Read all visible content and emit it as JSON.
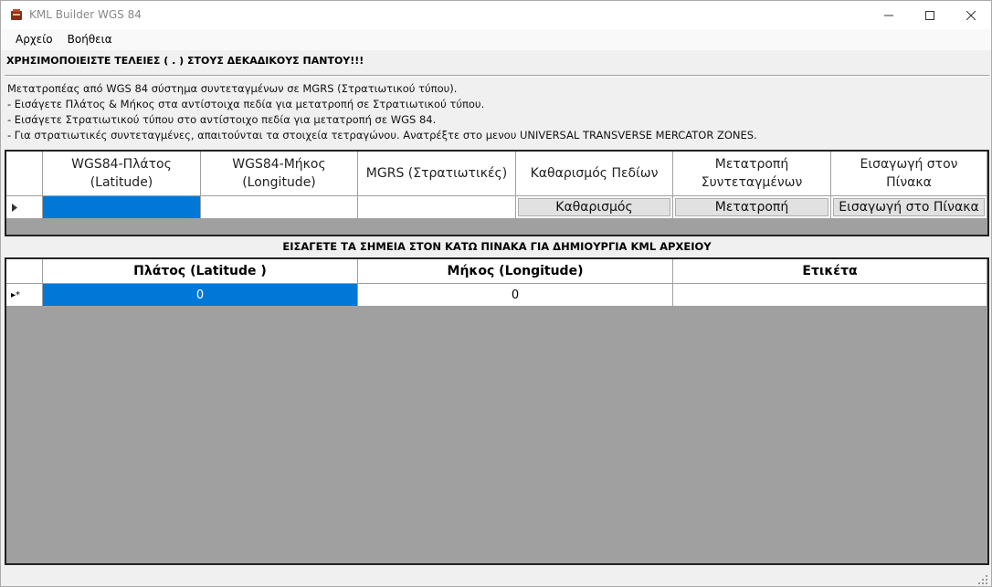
{
  "window": {
    "title": "KML Builder WGS 84"
  },
  "menu": {
    "items": [
      "Αρχείο",
      "Βοήθεια"
    ]
  },
  "warning": "ΧΡΗΣΙΜΟΠΟΙΕΙΣΤΕ ΤΕΛΕΙΕΣ ( . ) ΣΤΟΥΣ ΔΕΚΑΔΙΚΟΥΣ ΠΑΝΤΟΥ!!!",
  "info_lines": [
    "Μετατροπέας από WGS 84 σύστημα συντεταγμένων σε MGRS (Στρατιωτικού τύπου).",
    "- Εισάγετε Πλάτος & Μήκος στα αντίστοιχα πεδία για μετατροπή σε Στρατιωτικού τύπου.",
    "- Εισάγετε Στρατιωτικού τύπου στο αντίστοιχο πεδία για μετατροπή σε WGS 84.",
    "- Για στρατιωτικές συντεταγμένες, απαιτούνται τα στοιχεία τετραγώνου. Ανατρέξτε στο μενου UNIVERSAL TRANSVERSE MERCATOR ZONES."
  ],
  "converter_grid": {
    "headers": [
      "WGS84-Πλάτος\n(Latitude)",
      "WGS84-Μήκος\n(Longitude)",
      "MGRS (Στρατιωτικές)",
      "Καθαρισμός Πεδίων",
      "Μετατροπή\nΣυντεταγμένων",
      "Εισαγωγή στον\nΠίνακα"
    ],
    "row": {
      "latitude": "",
      "longitude": "",
      "mgrs": "",
      "clear_button": "Καθαρισμός",
      "convert_button": "Μετατροπή",
      "insert_button": "Εισαγωγή στο Πίνακα"
    }
  },
  "points_label": "ΕΙΣΑΓΕΤΕ ΤΑ ΣΗΜΕΙΑ ΣΤΟΝ ΚΑΤΩ ΠΙΝΑΚΑ ΓΙΑ ΔΗΜΙΟΥΡΓΙΑ KML ΑΡΧΕΙΟΥ",
  "points_grid": {
    "headers": [
      "Πλάτος (Latitude )",
      "Μήκος (Longitude)",
      "Ετικέτα"
    ],
    "row_marker": "▸*",
    "row": {
      "latitude": "0",
      "longitude": "0",
      "label": ""
    }
  },
  "colors": {
    "selection": "#0078d7",
    "grid_background": "#a0a0a0"
  }
}
